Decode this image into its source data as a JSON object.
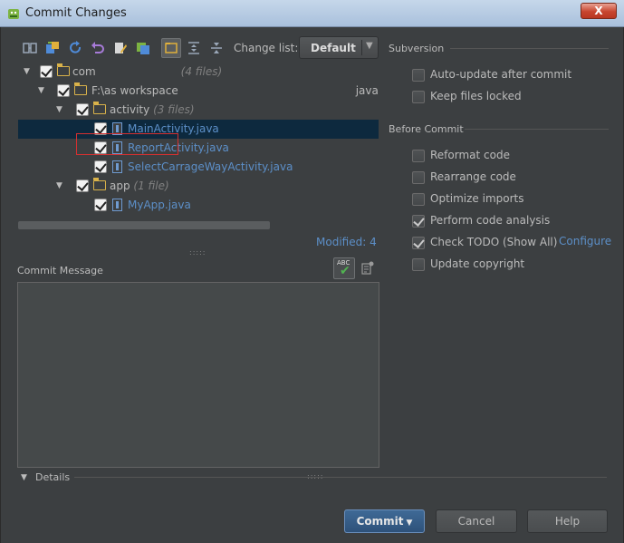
{
  "window": {
    "title": "Commit Changes",
    "close_label": "X"
  },
  "toolbar": {
    "changelist_label": "Change list:",
    "changelist_value": "Default",
    "icons": [
      "diff-icon",
      "move-icon",
      "refresh-icon",
      "rollback-icon",
      "edit-icon",
      "history-icon",
      "group-by-directory-icon",
      "expand-all-icon",
      "collapse-all-icon"
    ]
  },
  "tree": {
    "rows": [
      {
        "label": "com",
        "count": "(4 files)"
      },
      {
        "label": "F:\\as workspace",
        "suffix": "java"
      },
      {
        "label": "activity",
        "count": "(3 files)"
      },
      {
        "label": "MainActivity.java"
      },
      {
        "label": "ReportActivity.java"
      },
      {
        "label": "SelectCarrageWayActivity.java"
      },
      {
        "label": "app",
        "count": "(1 file)"
      },
      {
        "label": "MyApp.java"
      }
    ],
    "modified": "Modified: 4"
  },
  "commit_message": {
    "label": "Commit Message",
    "value": "",
    "spell_label": "ABC"
  },
  "details": {
    "label": "Details"
  },
  "subversion": {
    "title": "Subversion",
    "options": [
      {
        "label": "Auto-update after commit",
        "checked": false
      },
      {
        "label": "Keep files locked",
        "checked": false
      }
    ]
  },
  "before_commit": {
    "title": "Before Commit",
    "options": [
      {
        "label": "Reformat code",
        "checked": false
      },
      {
        "label": "Rearrange code",
        "checked": false
      },
      {
        "label": "Optimize imports",
        "checked": false
      },
      {
        "label": "Perform code analysis",
        "checked": true
      },
      {
        "label": "Check TODO (Show All)",
        "checked": true
      },
      {
        "label": "Update copyright",
        "checked": false
      }
    ],
    "configure_link": "Configure"
  },
  "buttons": {
    "commit": "Commit",
    "cancel": "Cancel",
    "help": "Help"
  },
  "colors": {
    "background": "#3c3f41",
    "accent": "#5c8fc8",
    "selection": "#0d293e",
    "highlight_border": "#d63030"
  }
}
